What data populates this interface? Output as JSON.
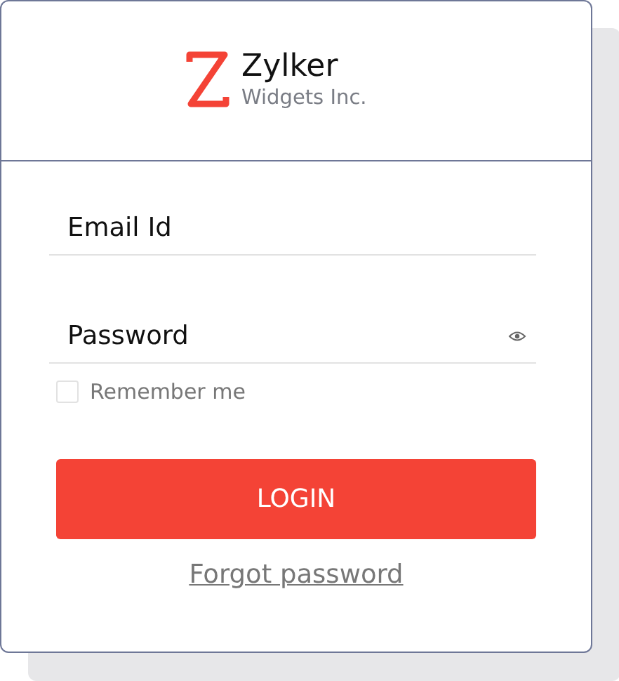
{
  "brand": {
    "name": "Zylker",
    "subtitle": "Widgets Inc."
  },
  "email": {
    "placeholder": "Email Id"
  },
  "password": {
    "placeholder": "Password"
  },
  "remember": {
    "label": "Remember me",
    "checked": false
  },
  "login_button": "LOGIN",
  "forgot_link": "Forgot password"
}
